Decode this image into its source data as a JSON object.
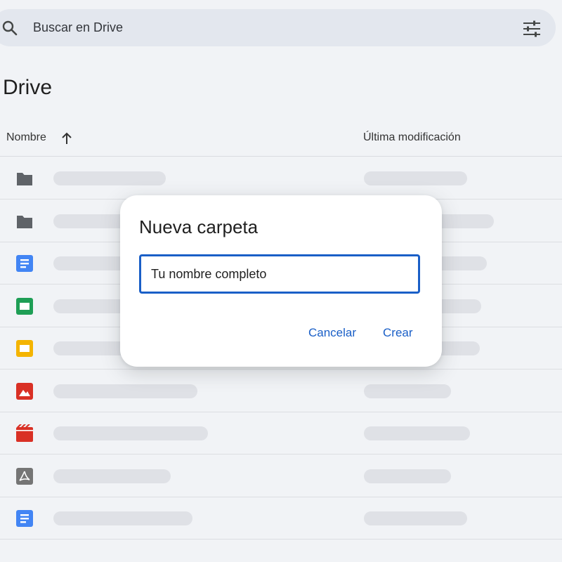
{
  "search": {
    "placeholder": "Buscar en Drive"
  },
  "page": {
    "title": "Drive"
  },
  "columns": {
    "name": "Nombre",
    "modified": "Última modificación"
  },
  "files": [
    {
      "type": "folder",
      "icon": "folder-icon"
    },
    {
      "type": "folder",
      "icon": "folder-icon"
    },
    {
      "type": "docs",
      "icon": "docs-icon"
    },
    {
      "type": "sheets",
      "icon": "sheets-icon"
    },
    {
      "type": "slides",
      "icon": "slides-icon"
    },
    {
      "type": "image",
      "icon": "image-icon"
    },
    {
      "type": "video",
      "icon": "video-icon"
    },
    {
      "type": "pdf",
      "icon": "pdf-icon"
    },
    {
      "type": "docs",
      "icon": "docs-icon"
    }
  ],
  "dialog": {
    "title": "Nueva carpeta",
    "input_value": "Tu nombre completo",
    "cancel_label": "Cancelar",
    "create_label": "Crear"
  },
  "colors": {
    "accent": "#1a5fc7",
    "folder": "#5f6368",
    "docs": "#4285f4",
    "sheets": "#1e9e55",
    "slides": "#f4b400",
    "image": "#d93025",
    "video": "#d93025",
    "pdf": "#757575"
  }
}
